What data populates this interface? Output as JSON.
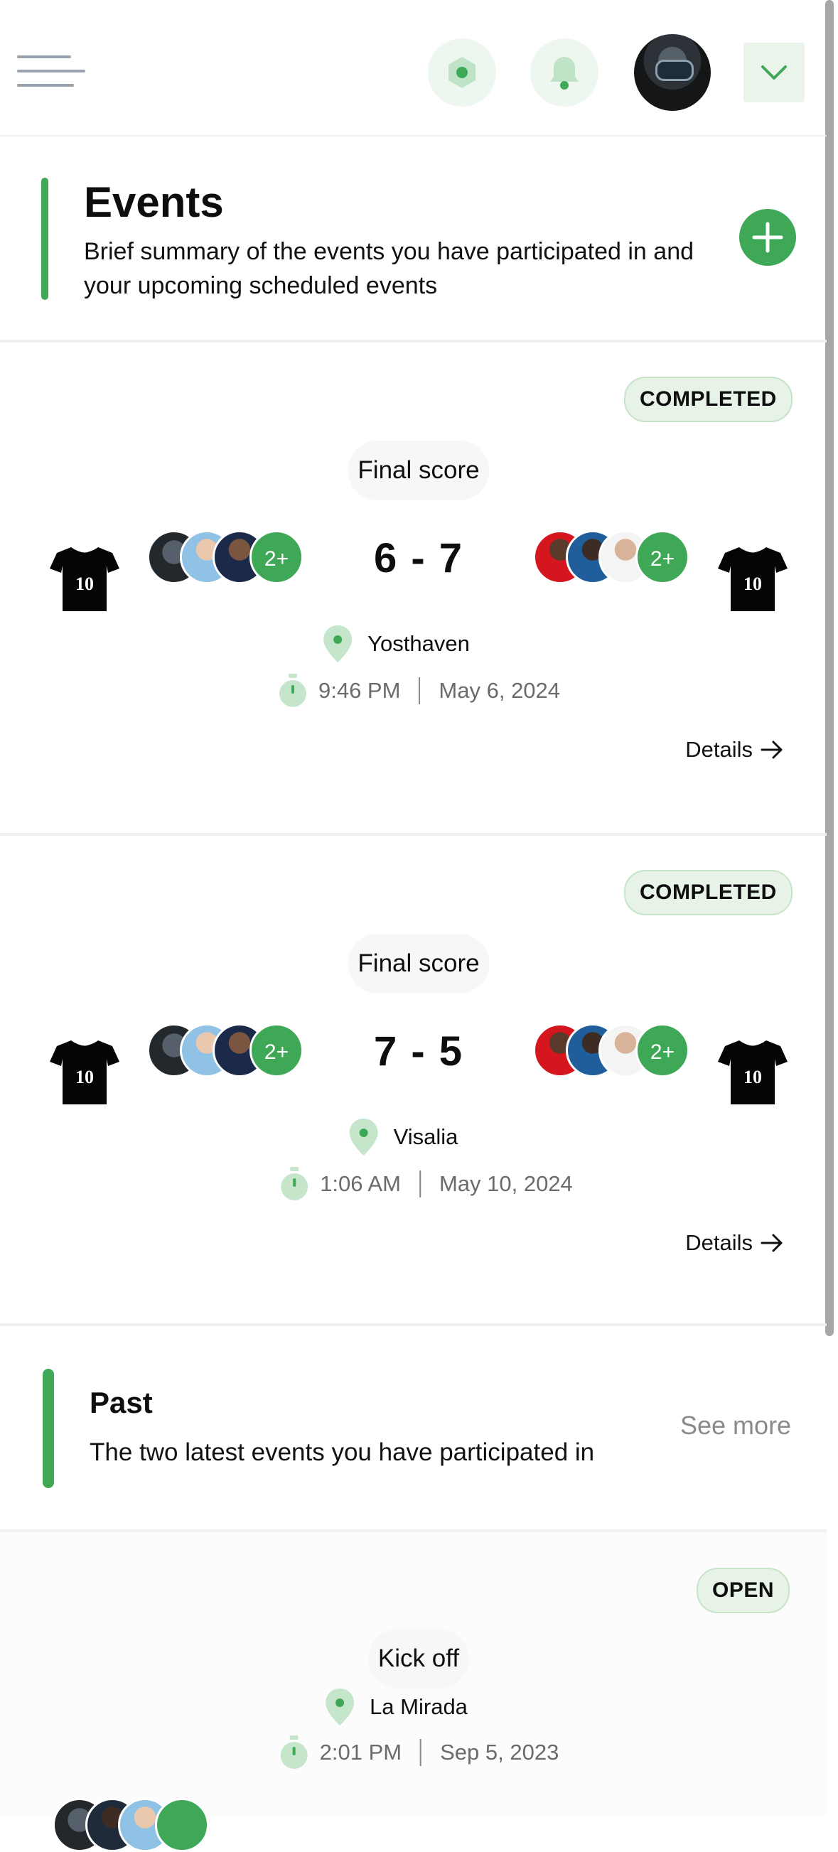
{
  "header": {
    "menu_icon": "hamburger-menu-icon",
    "status_icon": "hexagon-dot-icon",
    "notification_icon": "bell-icon",
    "profile_icon": "avatar",
    "dropdown_icon": "chevron-down-icon"
  },
  "events_section": {
    "title": "Events",
    "description": "Brief summary of the events you have participated in and your upcoming scheduled events",
    "add_icon": "plus-icon"
  },
  "events": [
    {
      "status": "COMPLETED",
      "label": "Final score",
      "score": "6 - 7",
      "home_more": "2+",
      "away_more": "2+",
      "jersey_number": "10",
      "location": "Yosthaven",
      "time": "9:46 PM",
      "date": "May 6, 2024",
      "details_label": "Details"
    },
    {
      "status": "COMPLETED",
      "label": "Final score",
      "score": "7 - 5",
      "home_more": "2+",
      "away_more": "2+",
      "jersey_number": "10",
      "location": "Visalia",
      "time": "1:06 AM",
      "date": "May 10, 2024",
      "details_label": "Details"
    }
  ],
  "past_section": {
    "title": "Past",
    "description": "The two latest events you have participated in",
    "see_more": "See more"
  },
  "past_events": [
    {
      "status": "OPEN",
      "label": "Kick off",
      "location": "La Mirada",
      "time": "2:01 PM",
      "date": "Sep 5, 2023"
    }
  ],
  "colors": {
    "accent": "#3fa856",
    "badge_bg": "#e6f3e6",
    "icon_bg": "#eef7ef"
  }
}
